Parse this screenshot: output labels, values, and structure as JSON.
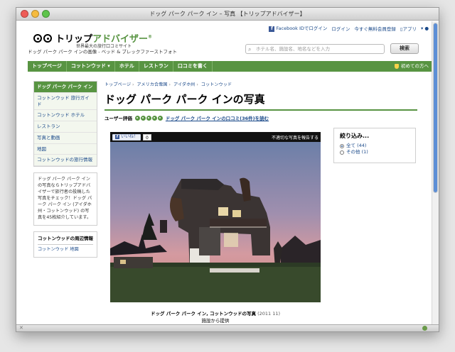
{
  "window": {
    "title": "ドッグ パーク パーク イン – 写真 【トリップアドバイザー】"
  },
  "header": {
    "facebook_login": "Facebook IDでログイン",
    "login": "ログイン",
    "register": "今すぐ無料会員登録",
    "app": "アプリ",
    "logo_text_black": "トリップ",
    "logo_text_green": "アドバイザー",
    "logo_reg": "®",
    "tagline": "世界最大の旅行口コミサイト",
    "subtitle": "ドッグ パーク パーク インの画像 - ベッド & ブレックファーストフォト",
    "search_placeholder": "ホテル名、施設名、地名などを入力",
    "search_button": "検索"
  },
  "nav": {
    "items": [
      "トップページ",
      "コットンウッド ▾",
      "ホテル",
      "レストラン",
      "口コミを書く"
    ],
    "first_time": "初めての方へ"
  },
  "sidebar": {
    "menu": [
      "ドッグ パーク パーク イン",
      "コットンウッド 旅行ガイド",
      "コットンウッド ホテル",
      "レストラン",
      "写真と動画",
      "地図",
      "コットンウッドの旅行情報"
    ],
    "promo_text": "ドッグ パーク パーク インの写真ならトリップアドバイザーで旅行者の投稿した写真をチェック！ドッグ パーク パーク イン (アイダホ州・コットンウッド) の写真を45枚紹介しています。",
    "nearby_title": "コットンウッドの周辺情報",
    "nearby_link": "コットンウッド 地図"
  },
  "main": {
    "breadcrumb": [
      "トップページ",
      "アメリカ合衆国",
      "アイダホ州",
      "コットンウッド"
    ],
    "title": "ドッグ パーク パーク インの写真",
    "rating_label": "ユーザー評価",
    "reviews_link": "ドッグ パーク パーク インの口コミ(36件)を読む",
    "like_label": "いいね！",
    "like_count": "0",
    "report_label": "不適切な写真を報告する",
    "caption_title": "ドッグ パーク パーク イン, コットンウッドの写真",
    "caption_year": "(2011 11)",
    "caption_provider": "施設から提供",
    "prev_arrow": "‹",
    "next_arrow": "›"
  },
  "filter": {
    "title": "絞り込み...",
    "options": [
      "全て (44)",
      "その他 (1)"
    ]
  }
}
